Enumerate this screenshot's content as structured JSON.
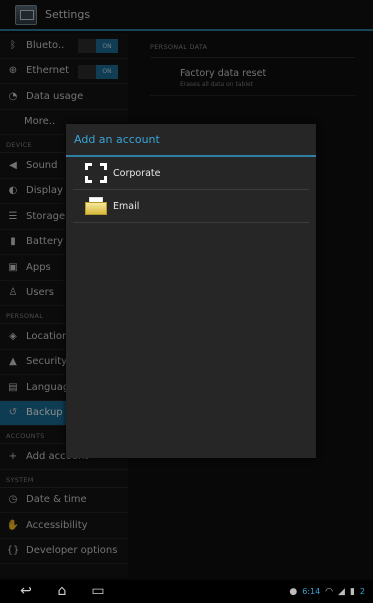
{
  "app": {
    "title": "Settings"
  },
  "left": {
    "wireless": [
      {
        "label": "Blueto..",
        "icon": "bluetooth-icon",
        "toggle": "ON"
      },
      {
        "label": "Ethernet",
        "icon": "ethernet-icon",
        "toggle": "ON"
      },
      {
        "label": "Data usage",
        "icon": "data-usage-icon"
      },
      {
        "label": "More.."
      }
    ],
    "device_header": "DEVICE",
    "device": [
      {
        "label": "Sound",
        "icon": "sound-icon"
      },
      {
        "label": "Display",
        "icon": "display-icon"
      },
      {
        "label": "Storage",
        "icon": "storage-icon"
      },
      {
        "label": "Battery",
        "icon": "battery-icon"
      },
      {
        "label": "Apps",
        "icon": "apps-icon"
      },
      {
        "label": "Users",
        "icon": "users-icon"
      }
    ],
    "personal_header": "PERSONAL",
    "personal": [
      {
        "label": "Location a",
        "icon": "location-icon"
      },
      {
        "label": "Security",
        "icon": "lock-icon"
      },
      {
        "label": "Language",
        "icon": "language-icon"
      },
      {
        "label": "Backup &",
        "icon": "backup-icon"
      }
    ],
    "accounts_header": "ACCOUNTS",
    "add_account": "Add account",
    "system_header": "SYSTEM",
    "system": [
      {
        "label": "Date & time",
        "icon": "clock-icon"
      },
      {
        "label": "Accessibility",
        "icon": "hand-icon"
      },
      {
        "label": "Developer options",
        "icon": "developer-icon"
      }
    ]
  },
  "right": {
    "header": "PERSONAL DATA",
    "item_title": "Factory data reset",
    "item_subtitle": "Erases all data on tablet"
  },
  "dialog": {
    "title": "Add an account",
    "options": [
      {
        "label": "Corporate",
        "icon": "corporate-icon"
      },
      {
        "label": "Email",
        "icon": "email-icon"
      }
    ]
  },
  "status": {
    "time": "6:14",
    "signal": "2"
  },
  "colors": {
    "accent": "#2f7fa3",
    "selected": "#1a6f98",
    "dialog_title": "#3aa4d6"
  }
}
